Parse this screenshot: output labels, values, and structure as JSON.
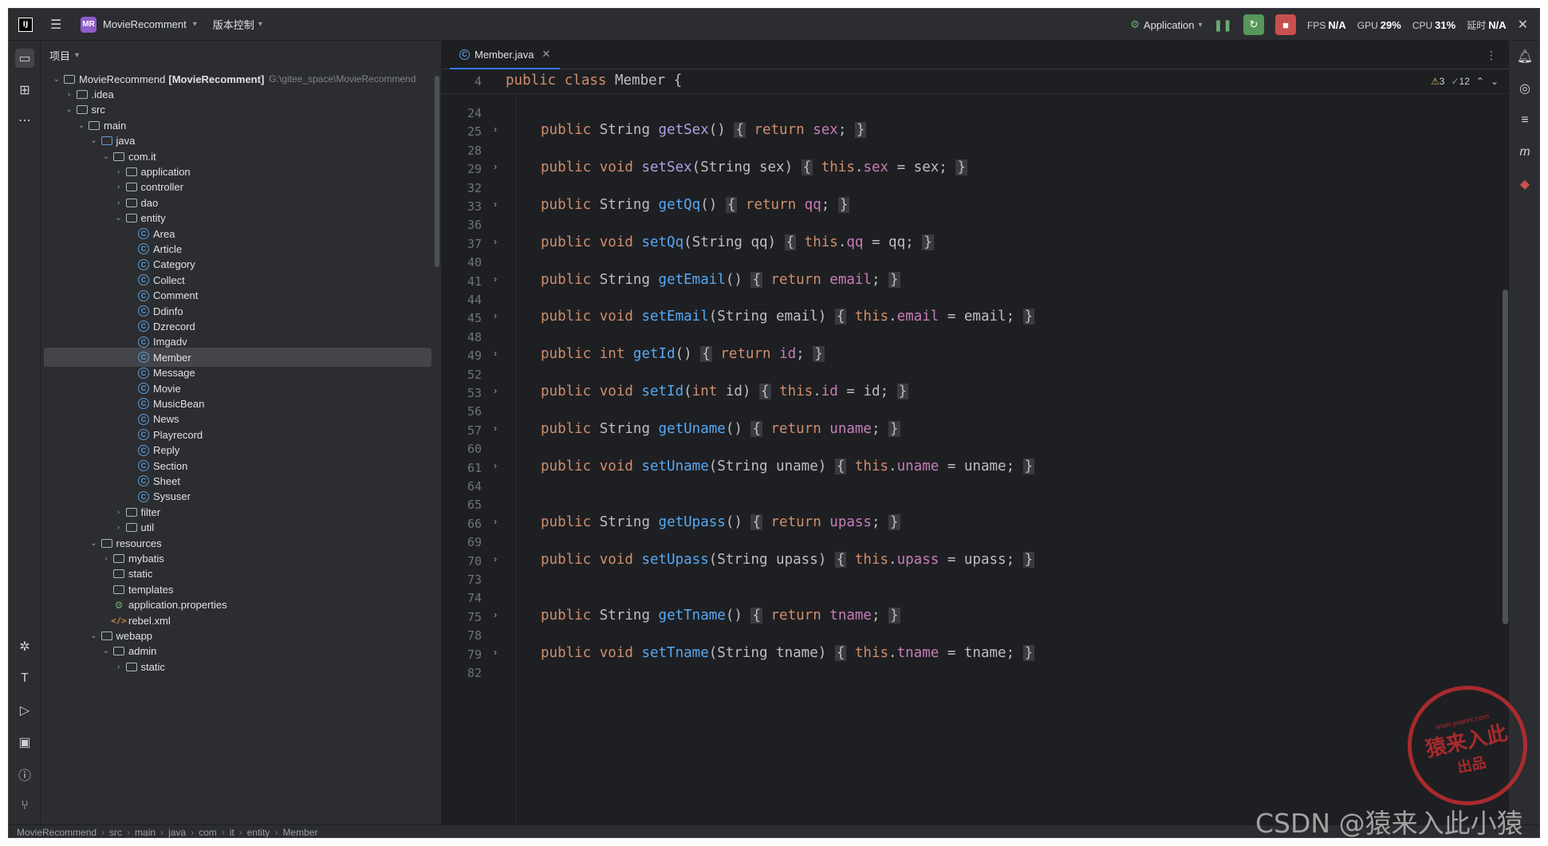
{
  "titlebar": {
    "logo": "IJ",
    "project_badge": "MR",
    "project_name": "MovieRecomment",
    "vcs_label": "版本控制",
    "run_config": "Application",
    "fps_label": "FPS",
    "fps_value": "N/A",
    "gpu_label": "GPU",
    "gpu_value": "29%",
    "cpu_label": "CPU",
    "cpu_value": "31%",
    "time_label": "延时",
    "time_value": "N/A"
  },
  "project_panel": {
    "title": "项目",
    "root_name": "MovieRecommend",
    "root_module": "[MovieRecomment]",
    "root_path": "G:\\gitee_space\\MovieRecommend",
    "items": [
      {
        "label": ".idea",
        "depth": 1,
        "type": "folder",
        "expanded": false
      },
      {
        "label": "src",
        "depth": 1,
        "type": "folder",
        "expanded": true
      },
      {
        "label": "main",
        "depth": 2,
        "type": "folder",
        "expanded": true
      },
      {
        "label": "java",
        "depth": 3,
        "type": "src",
        "expanded": true
      },
      {
        "label": "com.it",
        "depth": 4,
        "type": "folder",
        "expanded": true
      },
      {
        "label": "application",
        "depth": 5,
        "type": "folder",
        "expanded": false
      },
      {
        "label": "controller",
        "depth": 5,
        "type": "folder",
        "expanded": false
      },
      {
        "label": "dao",
        "depth": 5,
        "type": "folder",
        "expanded": false
      },
      {
        "label": "entity",
        "depth": 5,
        "type": "folder",
        "expanded": true
      },
      {
        "label": "Area",
        "depth": 6,
        "type": "class"
      },
      {
        "label": "Article",
        "depth": 6,
        "type": "class"
      },
      {
        "label": "Category",
        "depth": 6,
        "type": "class"
      },
      {
        "label": "Collect",
        "depth": 6,
        "type": "class"
      },
      {
        "label": "Comment",
        "depth": 6,
        "type": "class"
      },
      {
        "label": "Ddinfo",
        "depth": 6,
        "type": "class"
      },
      {
        "label": "Dzrecord",
        "depth": 6,
        "type": "class"
      },
      {
        "label": "Imgadv",
        "depth": 6,
        "type": "class"
      },
      {
        "label": "Member",
        "depth": 6,
        "type": "class",
        "selected": true
      },
      {
        "label": "Message",
        "depth": 6,
        "type": "class"
      },
      {
        "label": "Movie",
        "depth": 6,
        "type": "class"
      },
      {
        "label": "MusicBean",
        "depth": 6,
        "type": "class"
      },
      {
        "label": "News",
        "depth": 6,
        "type": "class"
      },
      {
        "label": "Playrecord",
        "depth": 6,
        "type": "class"
      },
      {
        "label": "Reply",
        "depth": 6,
        "type": "class"
      },
      {
        "label": "Section",
        "depth": 6,
        "type": "class"
      },
      {
        "label": "Sheet",
        "depth": 6,
        "type": "class"
      },
      {
        "label": "Sysuser",
        "depth": 6,
        "type": "class"
      },
      {
        "label": "filter",
        "depth": 5,
        "type": "folder",
        "expanded": false
      },
      {
        "label": "util",
        "depth": 5,
        "type": "folder",
        "expanded": false
      },
      {
        "label": "resources",
        "depth": 3,
        "type": "folder",
        "expanded": true
      },
      {
        "label": "mybatis",
        "depth": 4,
        "type": "folder",
        "expanded": false
      },
      {
        "label": "static",
        "depth": 4,
        "type": "folder",
        "leaf": true
      },
      {
        "label": "templates",
        "depth": 4,
        "type": "folder",
        "leaf": true
      },
      {
        "label": "application.properties",
        "depth": 4,
        "type": "props",
        "leaf": true
      },
      {
        "label": "rebel.xml",
        "depth": 4,
        "type": "xml",
        "leaf": true
      },
      {
        "label": "webapp",
        "depth": 3,
        "type": "folder",
        "expanded": true
      },
      {
        "label": "admin",
        "depth": 4,
        "type": "folder",
        "expanded": true
      },
      {
        "label": "static",
        "depth": 5,
        "type": "folder",
        "expanded": false
      }
    ]
  },
  "editor": {
    "tab_label": "Member.java",
    "warnings": "3",
    "checks": "12",
    "sticky_line_no": "4",
    "sticky_code": "public class Member {",
    "lines": [
      {
        "n": "24"
      },
      {
        "n": "25",
        "getter": true,
        "type": "String",
        "name": "getSex",
        "field": "sex"
      },
      {
        "n": "28"
      },
      {
        "n": "29",
        "setter": true,
        "name": "setSex",
        "ptype": "String",
        "param": "sex"
      },
      {
        "n": "32"
      },
      {
        "n": "33",
        "getter": true,
        "type": "String",
        "name": "getQq",
        "field": "qq"
      },
      {
        "n": "36"
      },
      {
        "n": "37",
        "setter": true,
        "name": "setQq",
        "ptype": "String",
        "param": "qq"
      },
      {
        "n": "40"
      },
      {
        "n": "41",
        "getter": true,
        "type": "String",
        "name": "getEmail",
        "field": "email"
      },
      {
        "n": "44"
      },
      {
        "n": "45",
        "setter": true,
        "name": "setEmail",
        "ptype": "String",
        "param": "email"
      },
      {
        "n": "48"
      },
      {
        "n": "49",
        "getter": true,
        "type": "int",
        "name": "getId",
        "field": "id",
        "prim": true
      },
      {
        "n": "52"
      },
      {
        "n": "53",
        "setter": true,
        "name": "setId",
        "ptype": "int",
        "param": "id",
        "prim": true
      },
      {
        "n": "56"
      },
      {
        "n": "57",
        "getter": true,
        "type": "String",
        "name": "getUname",
        "field": "uname"
      },
      {
        "n": "60"
      },
      {
        "n": "61",
        "setter": true,
        "name": "setUname",
        "ptype": "String",
        "param": "uname"
      },
      {
        "n": "64"
      },
      {
        "n": "65"
      },
      {
        "n": "66",
        "getter": true,
        "type": "String",
        "name": "getUpass",
        "field": "upass"
      },
      {
        "n": "69"
      },
      {
        "n": "70",
        "setter": true,
        "name": "setUpass",
        "ptype": "String",
        "param": "upass"
      },
      {
        "n": "73"
      },
      {
        "n": "74"
      },
      {
        "n": "75",
        "getter": true,
        "type": "String",
        "name": "getTname",
        "field": "tname"
      },
      {
        "n": "78"
      },
      {
        "n": "79",
        "setter": true,
        "name": "setTname",
        "ptype": "String",
        "param": "tname"
      },
      {
        "n": "82"
      }
    ]
  },
  "statusbar": {
    "crumbs": [
      "MovieRecommend",
      "src",
      "main",
      "java",
      "com",
      "it",
      "entity",
      "Member"
    ]
  },
  "watermark": {
    "text": "CSDN @猿来入此小猿",
    "stamp_url": "www.yuanrc.com",
    "stamp_main": "猿来入此",
    "stamp_sub": "出品"
  },
  "colors": {
    "background": "#1e1f22",
    "panel": "#2b2d30",
    "keyword": "#cf8e6d",
    "method": "#56a8f5",
    "field": "#c77dbb",
    "accent": "#3574f0"
  }
}
